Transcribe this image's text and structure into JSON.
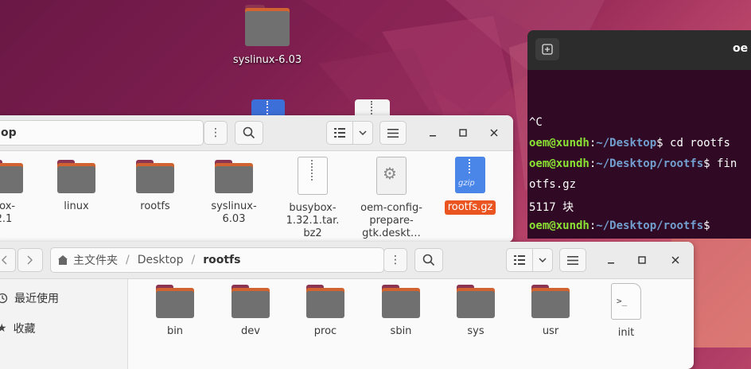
{
  "desktop": {
    "syslinux_label": "syslinux-6.03"
  },
  "window_back": {
    "path_text": "op",
    "items": [
      {
        "label": "box-\n2.1",
        "type": "folder"
      },
      {
        "label": "linux",
        "type": "folder"
      },
      {
        "label": "rootfs",
        "type": "folder"
      },
      {
        "label": "syslinux-\n6.03",
        "type": "folder"
      },
      {
        "label": "busybox-\n1.32.1.tar.\nbz2",
        "type": "archive"
      },
      {
        "label": "oem-config-\nprepare-\ngtk.deskt…",
        "type": "desktop"
      },
      {
        "label": "rootfs.gz",
        "type": "gzip",
        "selected": true
      }
    ],
    "gzip_badge": "gzip"
  },
  "terminal": {
    "title": "oe",
    "lines": [
      {
        "text": "^C"
      },
      {
        "user": "oem@xundh",
        "path": "~/Desktop",
        "cmd": "$ cd rootfs"
      },
      {
        "user": "oem@xundh",
        "path": "~/Desktop/rootfs",
        "cmd": "$ fin"
      },
      {
        "text": "otfs.gz"
      },
      {
        "text": "5117 块"
      },
      {
        "user": "oem@xundh",
        "path": "~/Desktop/rootfs",
        "cmd": "$"
      }
    ]
  },
  "window_front": {
    "breadcrumb": {
      "home": "主文件夹",
      "sep1": "/",
      "desktop": "Desktop",
      "sep2": "/",
      "current": "rootfs"
    },
    "sidebar": [
      {
        "label": "最近使用",
        "icon": "clock-icon"
      },
      {
        "label": "收藏",
        "icon": "star-icon"
      }
    ],
    "items": [
      {
        "label": "bin",
        "type": "folder"
      },
      {
        "label": "dev",
        "type": "folder"
      },
      {
        "label": "proc",
        "type": "folder"
      },
      {
        "label": "sbin",
        "type": "folder"
      },
      {
        "label": "sys",
        "type": "folder"
      },
      {
        "label": "usr",
        "type": "folder"
      },
      {
        "label": "init",
        "type": "script"
      }
    ],
    "script_glyph": ">_"
  },
  "colors": {
    "selection": "#e95420",
    "folder_front": "#707070",
    "folder_back": "#d0632f",
    "terminal_bg": "#300a24"
  }
}
